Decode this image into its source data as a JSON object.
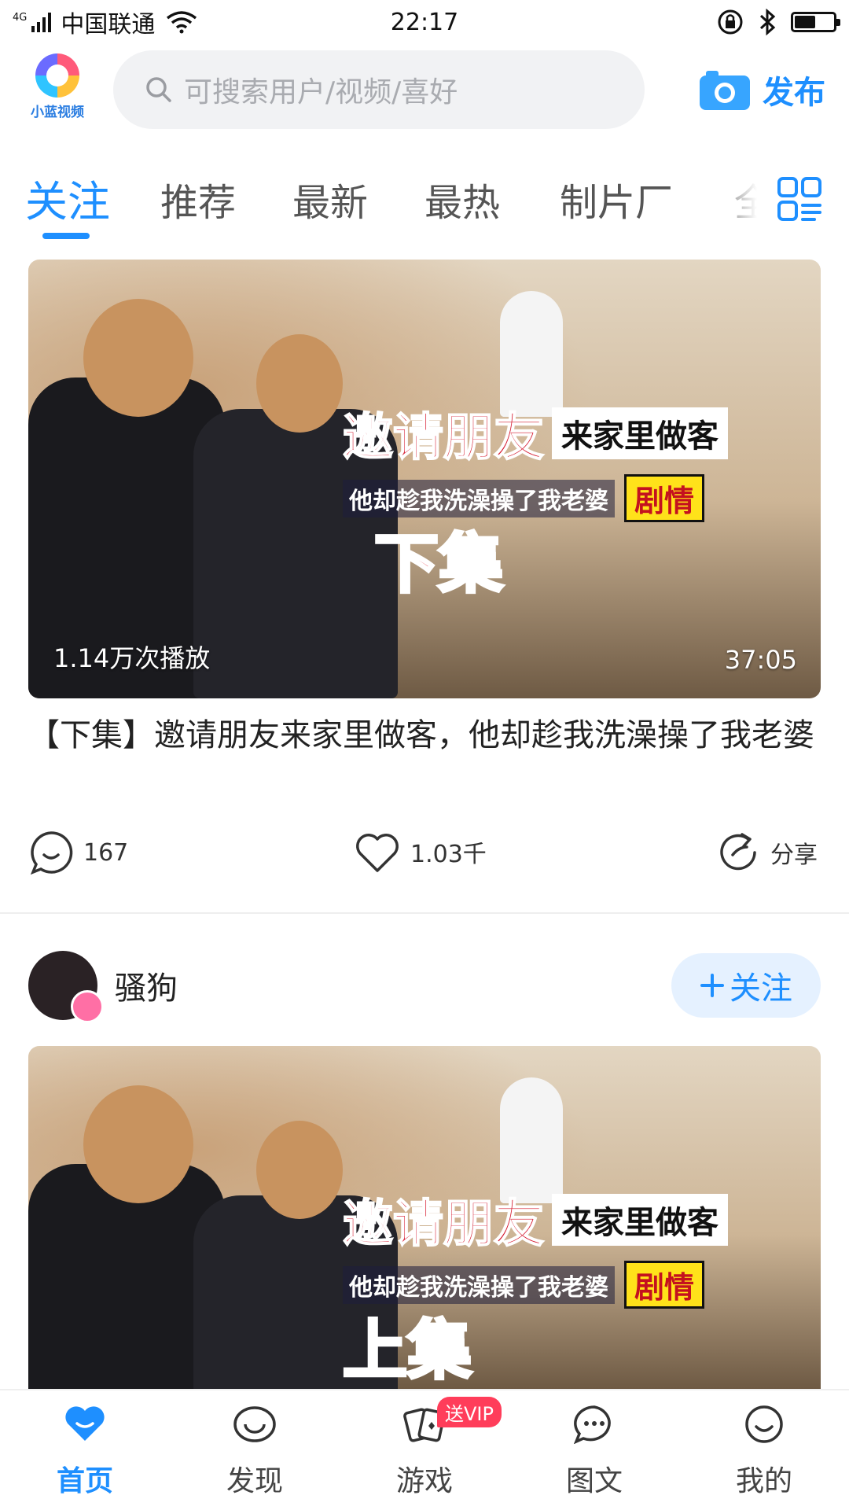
{
  "status_bar": {
    "network": "4G",
    "carrier": "中国联通",
    "time": "22:17",
    "battery_level": 0.55
  },
  "header": {
    "logo_text": "小蓝视频",
    "search_placeholder": "可搜索用户/视频/喜好",
    "publish_label": "发布"
  },
  "tabs": [
    {
      "label": "关注",
      "active": true
    },
    {
      "label": "推荐",
      "active": false
    },
    {
      "label": "最新",
      "active": false
    },
    {
      "label": "最热",
      "active": false
    },
    {
      "label": "制片厂",
      "active": false
    },
    {
      "label": "全",
      "active": false
    }
  ],
  "feed": {
    "first_card": {
      "banner_line1_a": "邀请朋友",
      "banner_line1_b": "来家里做客",
      "banner_line2": "他却趁我洗澡操了我老婆",
      "banner_tag": "剧情",
      "banner_part": "下集",
      "play_count": "1.14万次播放",
      "duration": "37:05",
      "title": "【下集】邀请朋友来家里做客，他却趁我洗澡操了我老婆",
      "comments": "167",
      "likes": "1.03千",
      "share_label": "分享"
    },
    "second_card": {
      "author_name": "骚狗",
      "follow_label": "关注",
      "banner_line1_a": "邀请朋友",
      "banner_line1_b": "来家里做客",
      "banner_line2": "他却趁我洗澡操了我老婆",
      "banner_tag": "剧情",
      "banner_part": "上集"
    }
  },
  "bottom_nav": [
    {
      "label": "首页",
      "icon": "home-heart-icon",
      "active": true
    },
    {
      "label": "发现",
      "icon": "eye-icon",
      "active": false
    },
    {
      "label": "游戏",
      "icon": "cards-icon",
      "active": false,
      "badge": "送VIP"
    },
    {
      "label": "图文",
      "icon": "chat-bubble-icon",
      "active": false
    },
    {
      "label": "我的",
      "icon": "smile-icon",
      "active": false
    }
  ],
  "colors": {
    "accent": "#1e8fff",
    "badge": "#ff3d5a"
  }
}
